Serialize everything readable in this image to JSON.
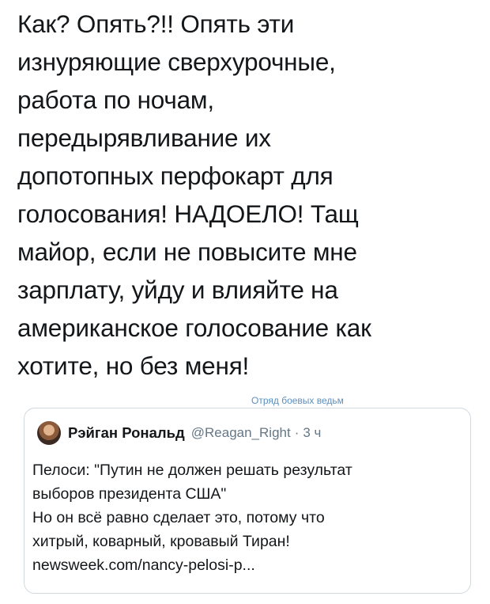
{
  "tweet": {
    "lines": [
      "Как? Опять?!! Опять эти",
      "изнуряющие сверхурочные,",
      "работа по ночам,",
      "передырявливание их",
      "допотопных перфокарт для",
      "голосования! НАДОЕЛО! Тащ",
      "майор, если не повысите мне",
      "зарплату, уйду и влияйте на",
      "американское голосование как",
      "хотите, но без меня!"
    ]
  },
  "watermark": "Отряд боевых ведьм",
  "quote": {
    "author_name": "Рэйган Рональд",
    "handle": "@Reagan_Right",
    "separator": "·",
    "time": "3 ч",
    "lines": [
      "Пелоси: \"Путин не должен решать результат",
      "выборов президента США\"",
      "Но он всё равно сделает это, потому что",
      "хитрый, коварный, кровавый Тиран!",
      "newsweek.com/nancy-pelosi-p..."
    ]
  }
}
